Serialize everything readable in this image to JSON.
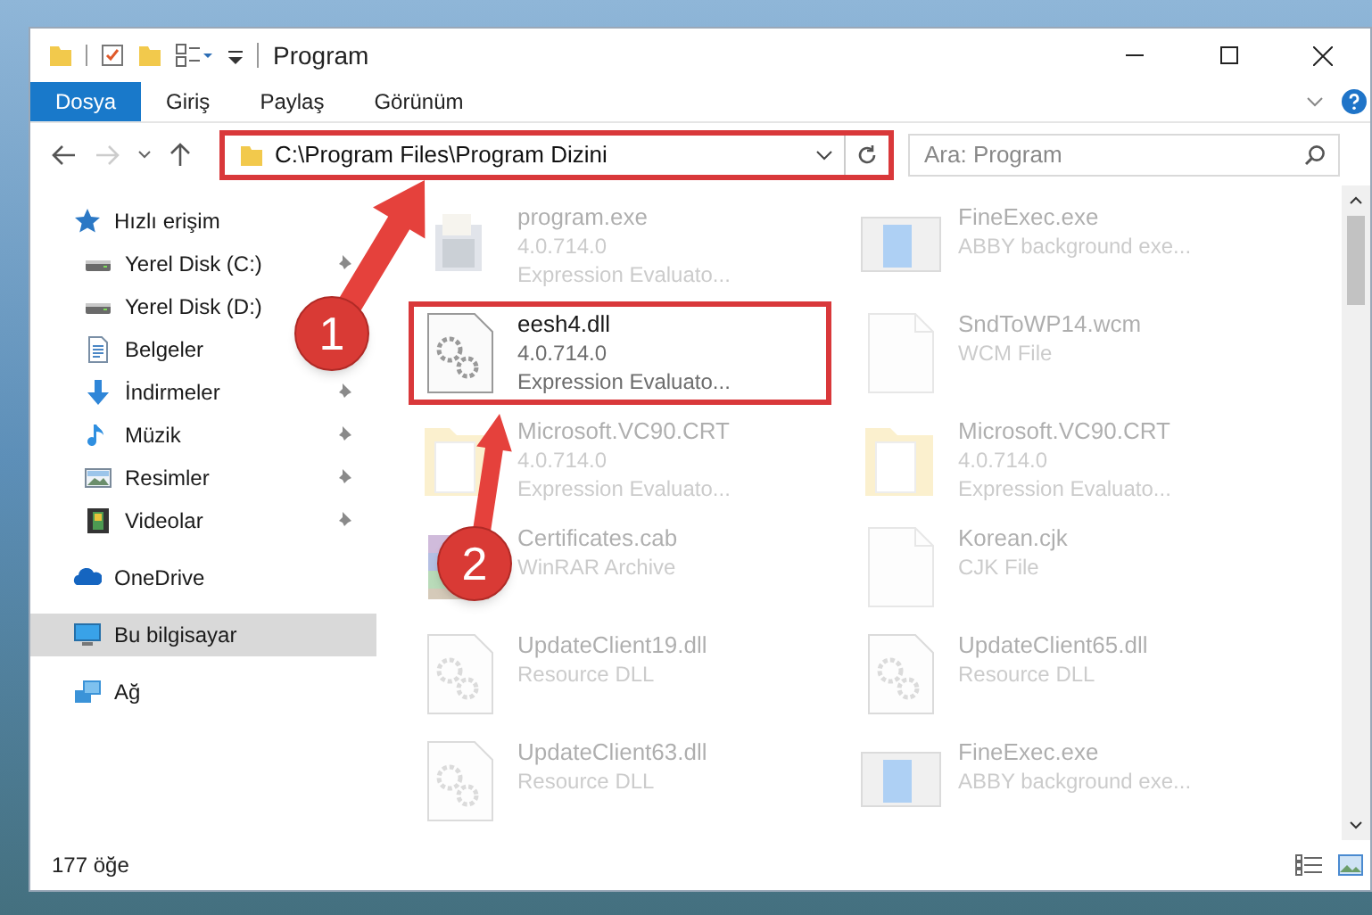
{
  "window": {
    "title": "Program"
  },
  "ribbon_tabs": [
    {
      "label": "Dosya",
      "selected": true
    },
    {
      "label": "Giriş",
      "selected": false
    },
    {
      "label": "Paylaş",
      "selected": false
    },
    {
      "label": "Görünüm",
      "selected": false
    }
  ],
  "address_bar": {
    "path": "C:\\Program Files\\Program Dizini",
    "highlighted": true
  },
  "search": {
    "placeholder": "Ara: Program"
  },
  "navigation": [
    {
      "label": "Hızlı erişim",
      "kind": "star",
      "selected": false,
      "children": [
        {
          "label": "Yerel Disk (C:)",
          "kind": "drive",
          "pinned": true,
          "selected": false
        },
        {
          "label": "Yerel Disk (D:)",
          "kind": "drive",
          "selected": false
        },
        {
          "label": "Belgeler",
          "kind": "documents",
          "selected": false
        },
        {
          "label": "İndirmeler",
          "kind": "downloads",
          "pinned": true,
          "selected": false
        },
        {
          "label": "Müzik",
          "kind": "music",
          "pinned": true,
          "selected": false
        },
        {
          "label": "Resimler",
          "kind": "pictures",
          "pinned": true,
          "selected": false
        },
        {
          "label": "Videolar",
          "kind": "videos",
          "pinned": true,
          "selected": false
        }
      ]
    },
    {
      "label": "OneDrive",
      "kind": "cloud",
      "selected": false
    },
    {
      "label": "Bu bilgisayar",
      "kind": "computer",
      "selected": true
    },
    {
      "label": "Ağ",
      "kind": "network",
      "selected": false
    }
  ],
  "files": [
    {
      "name": "program.exe",
      "lines": [
        "4.0.714.0",
        "Expression Evaluato..."
      ],
      "kind": "installer",
      "highlighted": false,
      "faded": true
    },
    {
      "name": "FineExec.exe",
      "lines": [
        "ABBY background exe..."
      ],
      "kind": "app",
      "highlighted": false,
      "faded": true
    },
    {
      "name": "eesh4.dll",
      "lines": [
        "4.0.714.0",
        "Expression Evaluato..."
      ],
      "kind": "dll",
      "highlighted": true,
      "faded": false
    },
    {
      "name": "SndToWP14.wcm",
      "lines": [
        "WCM File"
      ],
      "kind": "file",
      "highlighted": false,
      "faded": true
    },
    {
      "name": "Microsoft.VC90.CRT",
      "lines": [
        "4.0.714.0",
        "Expression Evaluato..."
      ],
      "kind": "folder",
      "highlighted": false,
      "faded": true
    },
    {
      "name": "Microsoft.VC90.CRT",
      "lines": [
        "4.0.714.0",
        "Expression Evaluato..."
      ],
      "kind": "folder",
      "highlighted": false,
      "faded": true
    },
    {
      "name": "Certificates.cab",
      "lines": [
        "WinRAR Archive"
      ],
      "kind": "archive",
      "highlighted": false,
      "faded": true
    },
    {
      "name": "Korean.cjk",
      "lines": [
        "CJK File"
      ],
      "kind": "file",
      "highlighted": false,
      "faded": true
    },
    {
      "name": "UpdateClient19.dll",
      "lines": [
        "Resource DLL"
      ],
      "kind": "dll",
      "highlighted": false,
      "faded": true
    },
    {
      "name": "UpdateClient65.dll",
      "lines": [
        "Resource DLL"
      ],
      "kind": "dll",
      "highlighted": false,
      "faded": true
    },
    {
      "name": "UpdateClient63.dll",
      "lines": [
        "Resource DLL"
      ],
      "kind": "dll",
      "highlighted": false,
      "faded": true
    },
    {
      "name": "FineExec.exe",
      "lines": [
        "ABBY background exe..."
      ],
      "kind": "app",
      "highlighted": false,
      "faded": true
    }
  ],
  "annotations": [
    {
      "number": "1"
    },
    {
      "number": "2"
    }
  ],
  "status_bar": {
    "item_count": "177 öğe"
  }
}
